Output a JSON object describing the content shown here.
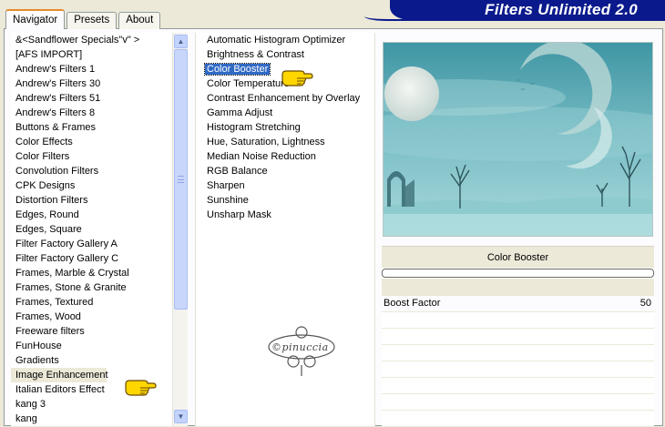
{
  "window": {
    "title": "Filters Unlimited 2.0"
  },
  "tabs": [
    {
      "label": "Navigator",
      "active": true
    },
    {
      "label": "Presets",
      "active": false
    },
    {
      "label": "About",
      "active": false
    }
  ],
  "categories": [
    "&<Sandflower Specials\"v\" >",
    "[AFS IMPORT]",
    "Andrew's Filters 1",
    "Andrew's Filters 30",
    "Andrew's Filters 51",
    "Andrew's Filters 8",
    "Buttons & Frames",
    "Color Effects",
    "Color Filters",
    "Convolution Filters",
    "CPK Designs",
    "Distortion Filters",
    "Edges, Round",
    "Edges, Square",
    "Filter Factory Gallery A",
    "Filter Factory Gallery C",
    "Frames, Marble & Crystal",
    "Frames, Stone & Granite",
    "Frames, Textured",
    "Frames, Wood",
    "Freeware filters",
    "FunHouse",
    "Gradients",
    "Image Enhancement",
    "Italian Editors Effect",
    "kang 3",
    "kang"
  ],
  "selected_category": "Image Enhancement",
  "filters": [
    "Automatic Histogram Optimizer",
    "Brightness & Contrast",
    "Color Booster",
    "Color Temperature",
    "Contrast Enhancement by Overlay",
    "Gamma Adjust",
    "Histogram Stretching",
    "Hue, Saturation, Lightness",
    "Median Noise Reduction",
    "RGB Balance",
    "Sharpen",
    "Sunshine",
    "Unsharp Mask"
  ],
  "selected_filter": "Color Booster",
  "filter_panel": {
    "name": "Color Booster",
    "params": [
      {
        "label": "Boost Factor",
        "value": "50"
      }
    ],
    "empty_rows": 7
  },
  "watermark": {
    "text": "©pinuccia"
  },
  "colors": {
    "banner": "#0a1a8c",
    "selection": "#316ac5",
    "preview_sky": "#5aa8b4"
  },
  "icons": {
    "hand_pointer": "pointing-hand-icon",
    "scroll_up": "arrow-up-icon",
    "scroll_down": "arrow-down-icon"
  }
}
